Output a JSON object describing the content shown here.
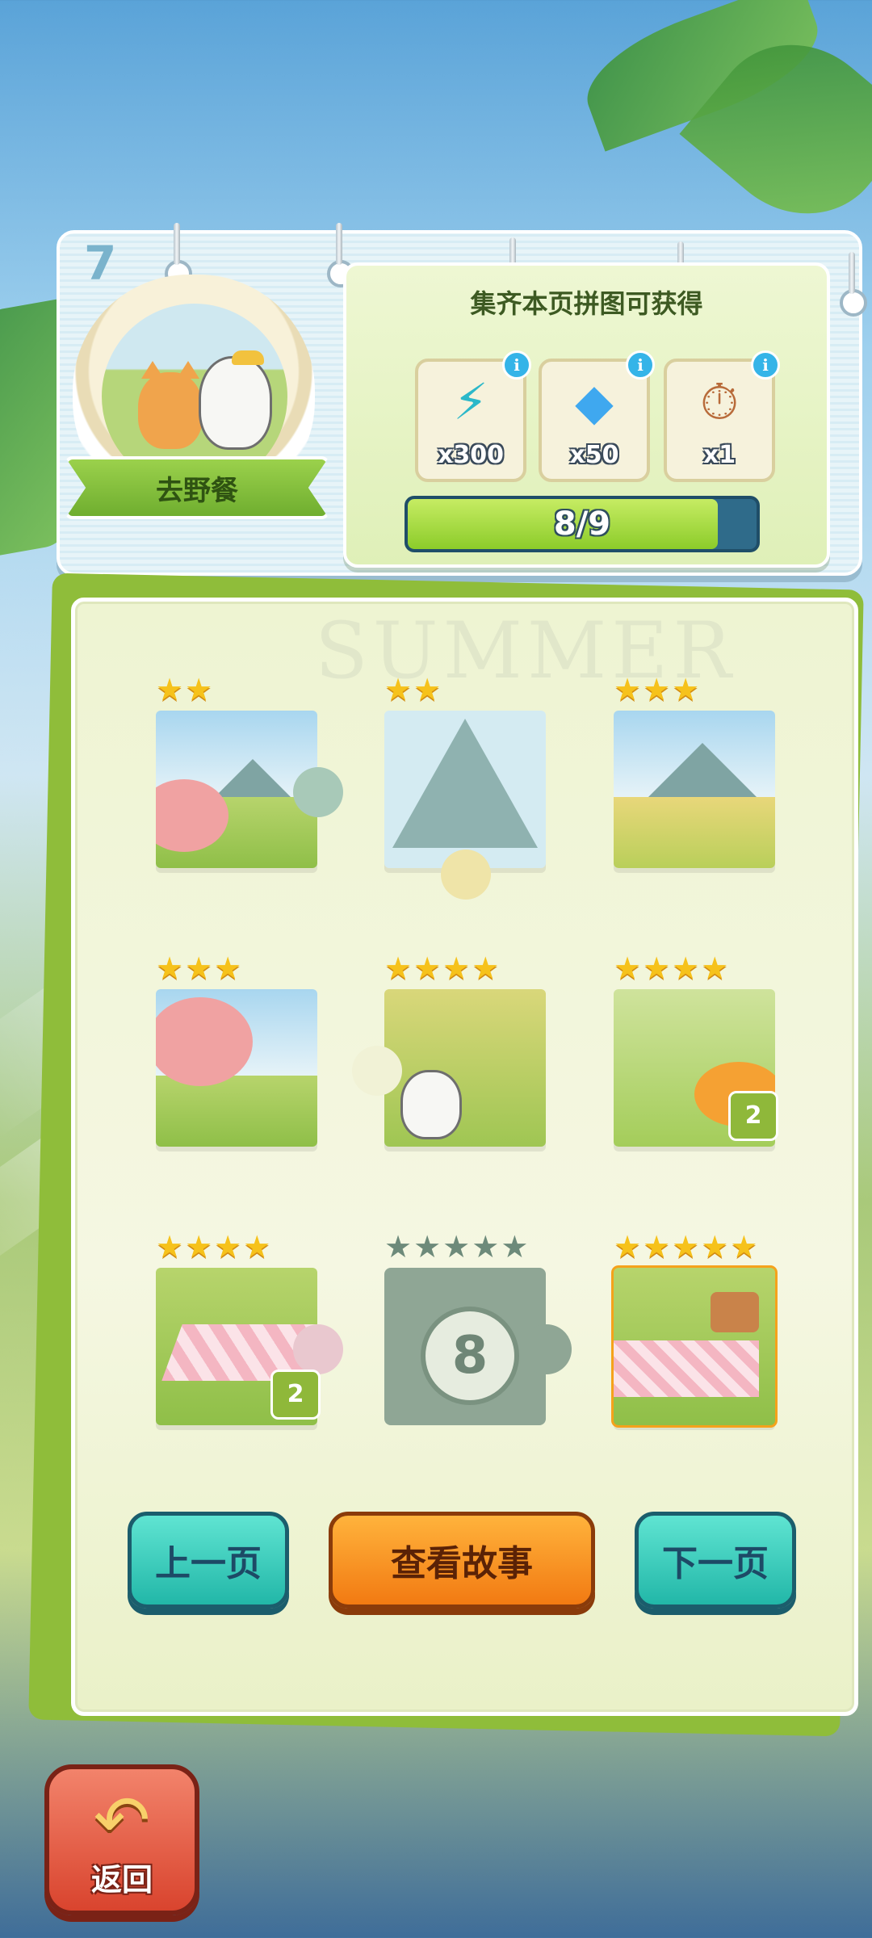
{
  "level": {
    "number": "7",
    "title": "去野餐"
  },
  "reward": {
    "title": "集齐本页拼图可获得",
    "items": [
      {
        "icon": "lightning-icon",
        "qty": "x300"
      },
      {
        "icon": "diamond-icon",
        "qty": "x50"
      },
      {
        "icon": "stopwatch-icon",
        "qty": "x1"
      }
    ],
    "progress": {
      "text": "8/9",
      "fraction": 0.889
    }
  },
  "watermark": "SUMMER",
  "pieces": [
    {
      "stars": 2,
      "max_stars": 2
    },
    {
      "stars": 2,
      "max_stars": 2
    },
    {
      "stars": 3,
      "max_stars": 3
    },
    {
      "stars": 3,
      "max_stars": 3
    },
    {
      "stars": 4,
      "max_stars": 4
    },
    {
      "stars": 4,
      "max_stars": 4,
      "count": "2"
    },
    {
      "stars": 4,
      "max_stars": 4,
      "count": "2"
    },
    {
      "stars": 0,
      "max_stars": 5,
      "locked": true,
      "number": "8"
    },
    {
      "stars": 5,
      "max_stars": 5,
      "selected": true
    }
  ],
  "buttons": {
    "prev": "上一页",
    "story": "查看故事",
    "next": "下一页",
    "back": "返回"
  },
  "colors": {
    "star_on": "#f6c21b",
    "star_off": "#6d8a7a",
    "accent_orange": "#f27a12",
    "accent_teal": "#22b7a8"
  }
}
